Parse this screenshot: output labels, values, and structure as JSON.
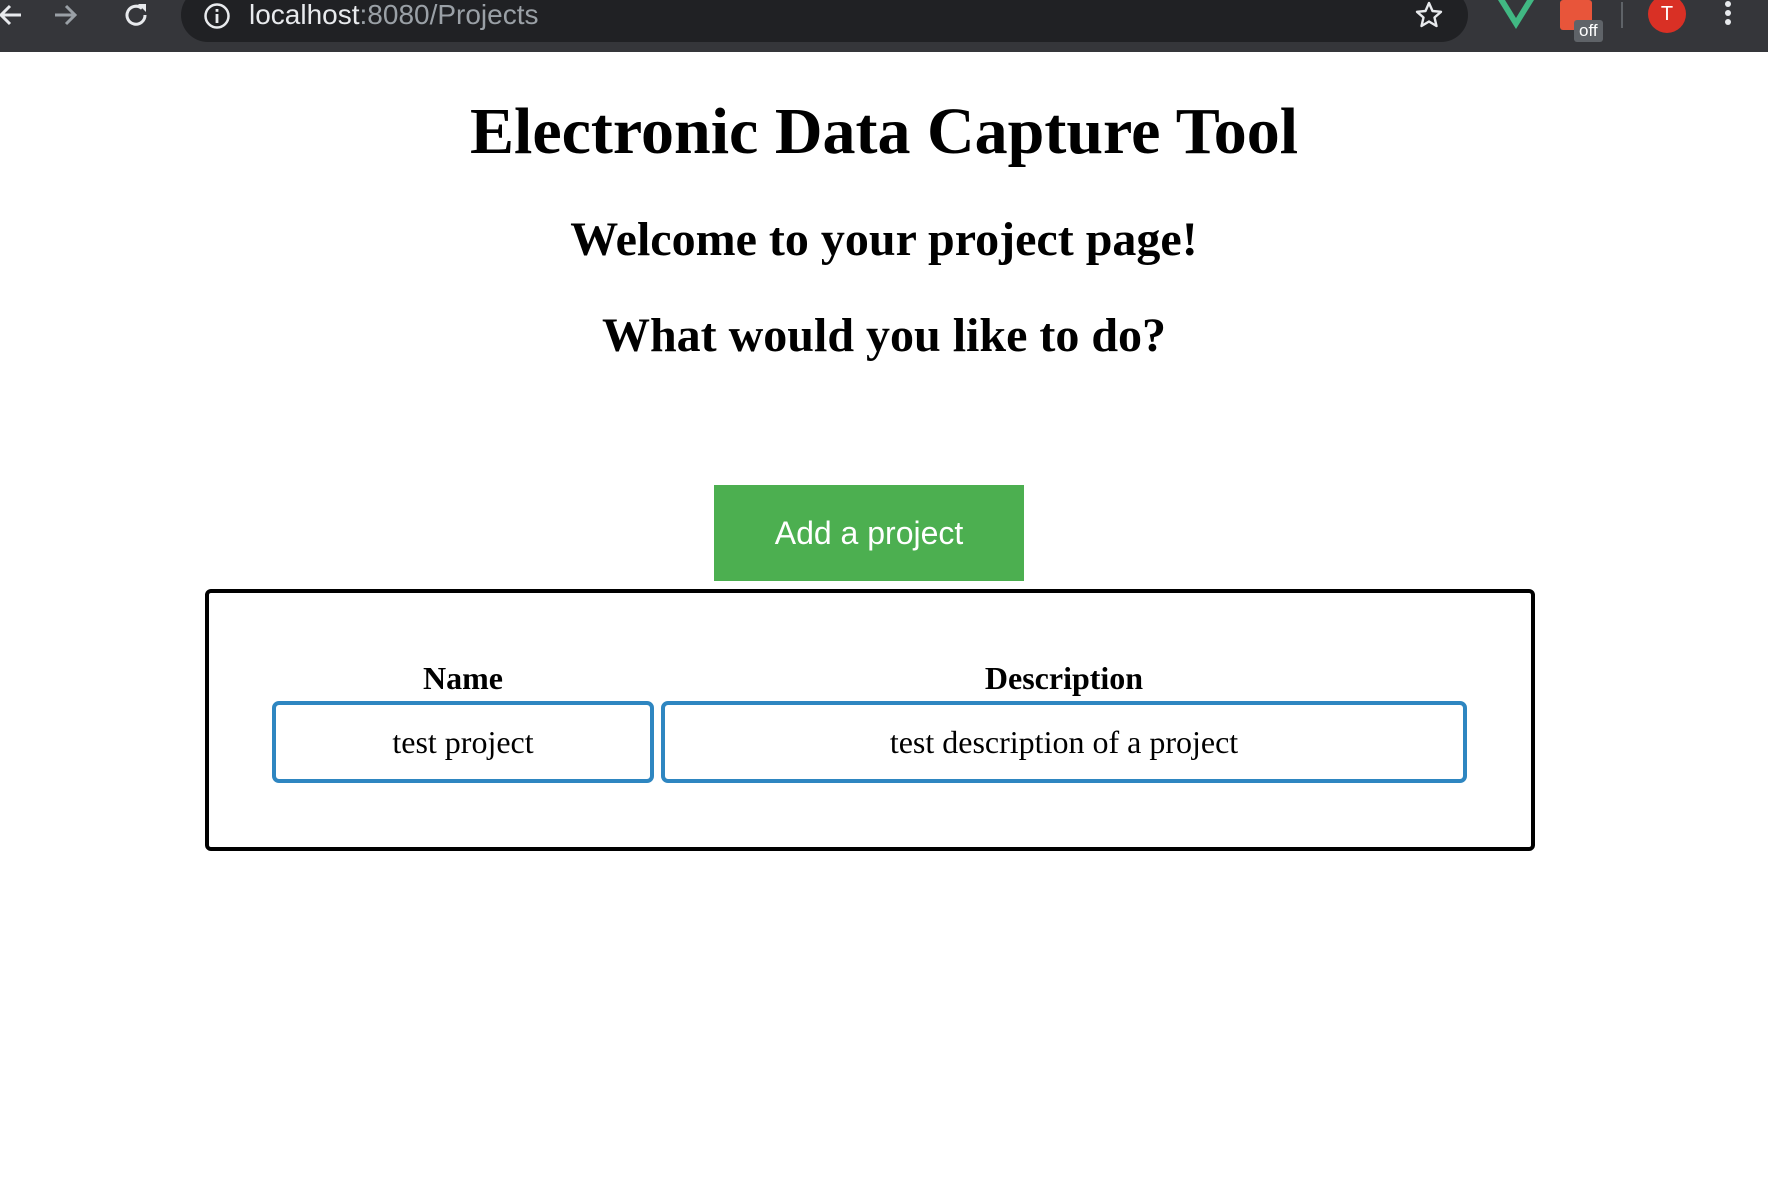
{
  "browser": {
    "url_host": "localhost",
    "url_rest": ":8080/Projects",
    "extension_badge": "off",
    "avatar_initial": "T",
    "colors": {
      "toolbar": "#35363a",
      "omnibox": "#202124",
      "avatar": "#d93025",
      "vue_green": "#41b883"
    }
  },
  "page": {
    "title": "Electronic Data Capture Tool",
    "welcome": "Welcome to your project page!",
    "question": "What would you like to do?",
    "add_button_label": "Add a project",
    "colors": {
      "button": "#4caf50",
      "cell_border": "#2e86c1"
    }
  },
  "projects_table": {
    "headers": {
      "name": "Name",
      "description": "Description"
    },
    "rows": [
      {
        "name": "test project",
        "description": "test description of a project"
      }
    ]
  }
}
